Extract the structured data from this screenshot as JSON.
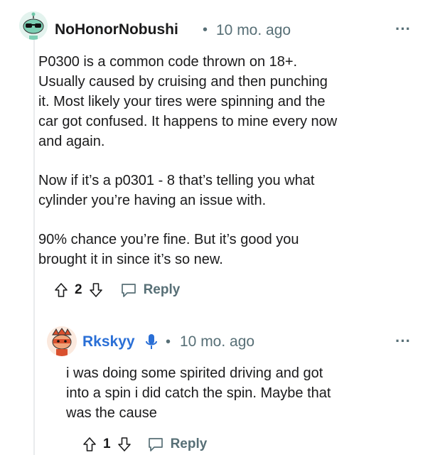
{
  "comment": {
    "username": "NoHonorNobushi",
    "separator": "•",
    "time": "10 mo. ago",
    "more": "···",
    "paragraphs": [
      [
        "P0300 is a common code thrown on 18+.",
        "Usually caused by cruising and then punching",
        "it. Most likely your tires were spinning and the",
        "car got confused. It happens to mine every now",
        "and again."
      ],
      [
        "Now if it’s a p0301 - 8 that’s telling you what",
        "cylinder you’re having an issue with."
      ],
      [
        "90% chance you’re fine. But it’s good you",
        "brought it in since it’s so new."
      ]
    ],
    "score": "2",
    "reply_label": "Reply"
  },
  "reply": {
    "username": "Rkskyy",
    "separator": "•",
    "time": "10 mo. ago",
    "more": "···",
    "lines": [
      "i was doing some spirited driving and got",
      "into a spin i did catch the spin. Maybe that",
      "was the cause"
    ],
    "score": "1",
    "reply_label": "Reply"
  },
  "colors": {
    "text": "#1a1a1b",
    "meta": "#576f76",
    "thread_line": "#e9ebed",
    "avatar1_bg": "#9ad8c4",
    "avatar2_bg": "#f3c9b0"
  },
  "icons": [
    "robot-avatar",
    "ninja-avatar",
    "upvote-icon",
    "downvote-icon",
    "comment-icon",
    "microphone-icon",
    "more-icon"
  ]
}
